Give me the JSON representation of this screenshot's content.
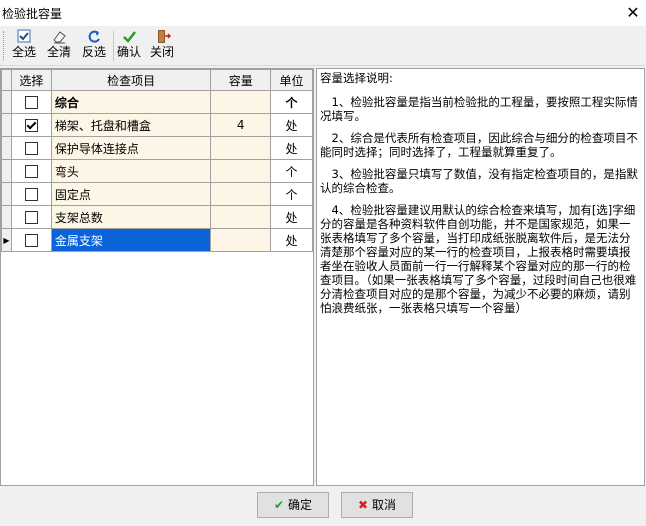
{
  "window": {
    "title": "检验批容量"
  },
  "toolbar": {
    "select_all": "全选",
    "clear_all": "全清",
    "invert": "反选",
    "confirm": "确认",
    "close": "关闭"
  },
  "grid": {
    "headers": {
      "select": "选择",
      "item": "检查项目",
      "capacity": "容量",
      "unit": "单位"
    },
    "rows": [
      {
        "checked": false,
        "name": "综合",
        "capacity": "",
        "unit": "个"
      },
      {
        "checked": true,
        "name": "梯架、托盘和槽盒",
        "capacity": "4",
        "unit": "处"
      },
      {
        "checked": false,
        "name": "保护导体连接点",
        "capacity": "",
        "unit": "处"
      },
      {
        "checked": false,
        "name": "弯头",
        "capacity": "",
        "unit": "个"
      },
      {
        "checked": false,
        "name": "固定点",
        "capacity": "",
        "unit": "个"
      },
      {
        "checked": false,
        "name": "支架总数",
        "capacity": "",
        "unit": "处"
      },
      {
        "checked": false,
        "name": "金属支架",
        "capacity": "",
        "unit": "处"
      }
    ]
  },
  "notes": {
    "title": "容量选择说明:",
    "p1": "　1、检验批容量是指当前检验批的工程量，要按照工程实际情况填写。",
    "p2": "　2、综合是代表所有检查项目，因此综合与细分的检查项目不能同时选择；同时选择了，工程量就算重复了。",
    "p3": "　3、检验批容量只填写了数值，没有指定检查项目的，是指默认的综合检查。",
    "p4": "　4、检验批容量建议用默认的综合检查来填写，加有[选]字细分的容量是各种资料软件自创功能，并不是国家规范，如果一张表格填写了多个容量，当打印成纸张脱离软件后，是无法分清楚那个容量对应的某一行的检查项目，上报表格时需要填报者坐在验收人员面前一行一行解释某个容量对应的那一行的检查项目。（如果一张表格填写了多个容量，过段时间自己也很难分清检查项目对应的是那个容量，为减少不必要的麻烦，请别怕浪费纸张，一张表格只填写一个容量）"
  },
  "footer": {
    "ok": "确定",
    "cancel": "取消"
  }
}
